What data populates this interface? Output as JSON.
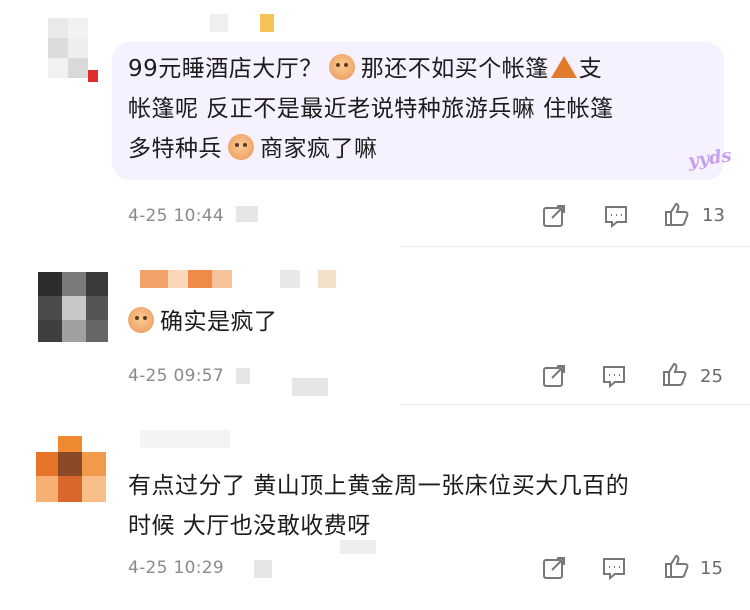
{
  "comments": [
    {
      "lines": [
        "99元睡酒店大厅？",
        "那还不如买个帐篷",
        "支",
        "帐篷呢 反正不是最近老说特种旅游兵嘛 住帐篷",
        "多特种兵",
        "商家疯了嘛"
      ],
      "sticker": "yyds",
      "time": "4-25 10:44",
      "likes": "13",
      "icons": [
        "share-icon",
        "reply-icon",
        "thumbs-up-icon"
      ]
    },
    {
      "lines": [
        "确实是疯了"
      ],
      "time": "4-25 09:57",
      "likes": "25",
      "icons": [
        "share-icon",
        "reply-icon",
        "thumbs-up-icon"
      ]
    },
    {
      "lines": [
        "有点过分了 黄山顶上黄金周一张床位买大几百的",
        "时候 大厅也没敢收费呀"
      ],
      "time": "4-25 10:29",
      "likes": "15",
      "icons": [
        "share-icon",
        "reply-icon",
        "thumbs-up-icon"
      ]
    }
  ],
  "emoji_names": [
    "pig-face-emoji",
    "tent-emoji",
    "drooling-face-emoji"
  ],
  "colors": {
    "bubble": "#f6f1ff",
    "text": "#1c1c1c",
    "meta": "#8a8a8a"
  }
}
